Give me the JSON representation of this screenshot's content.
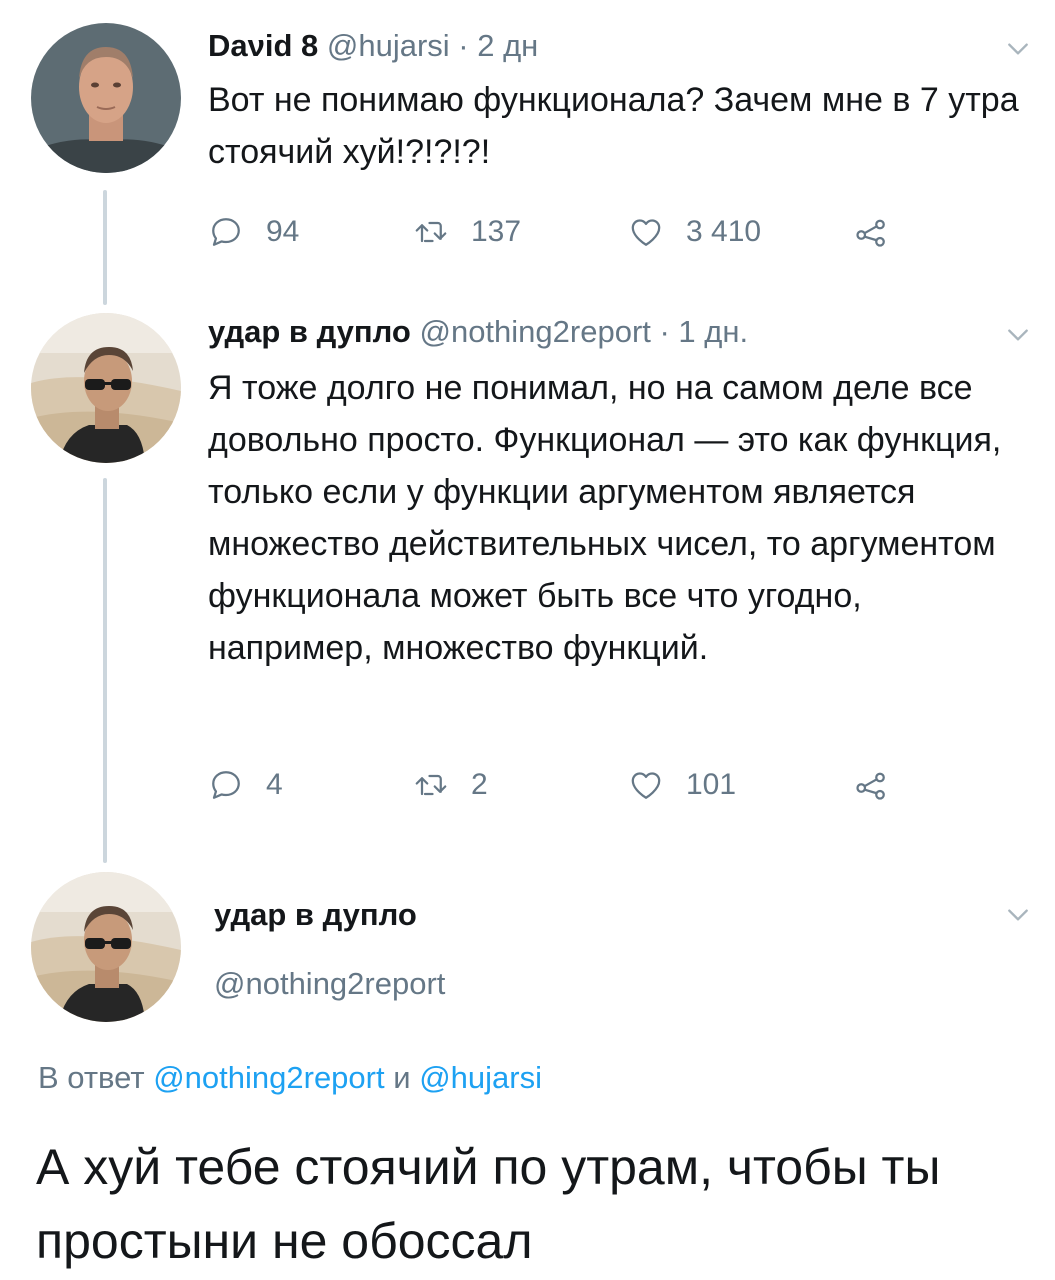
{
  "tweets": [
    {
      "display_name": "Daνid 8",
      "meta": "@hujarsi · 2 дн",
      "text": "Вот не понимаю функционала? Зачем мне в 7 утра стоячий хуй!?!?!?!",
      "replies": "94",
      "retweets": "137",
      "likes": "3 410"
    },
    {
      "display_name": "удар в дупло",
      "meta": "@nothing2report · 1 дн.",
      "text": "Я тоже долго не понимал, но на самом деле все довольно просто. Функционал — это как функция, только если у функции аргументом является множество действительных чисел, то аргументом функционала может быть все что угодно, например, множество функций.",
      "replies": "4",
      "retweets": "2",
      "likes": "101"
    }
  ],
  "main_tweet": {
    "display_name": "удар в дупло",
    "handle": "@nothing2report",
    "reply_prefix": "В ответ",
    "reply_mention_1": "@nothing2report",
    "reply_joiner": "и",
    "reply_mention_2": "@hujarsi",
    "text": "А хуй тебе стоячий по утрам, чтобы ты простыни не обоссал"
  },
  "icons": {
    "reply": "reply-icon",
    "retweet": "retweet-icon",
    "like": "heart-icon",
    "share": "share-icon",
    "caret": "chevron-down-icon"
  },
  "colors": {
    "text": "#14171a",
    "secondary": "#657786",
    "link": "#1da1f2",
    "thread_line": "#ccd6dd"
  }
}
